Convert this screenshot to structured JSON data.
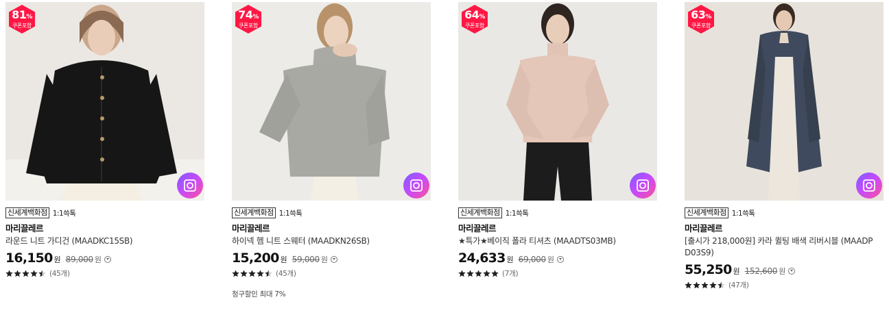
{
  "colors": {
    "badge": "#ff1744",
    "text": "#111111",
    "muted": "#666666"
  },
  "products": [
    {
      "discount": "81",
      "pct_sign": "%",
      "coupon": "쿠폰포함",
      "dept": "신세계백화점",
      "talk": "1:1쓱톡",
      "brand": "마리끌레르",
      "name": "라운드 니트 가디건 (MAADKC15SB)",
      "price": "16,150",
      "won": "원",
      "orig_price": "89,000",
      "rating": 4.5,
      "reviews": "(45개)",
      "note": ""
    },
    {
      "discount": "74",
      "pct_sign": "%",
      "coupon": "쿠폰포함",
      "dept": "신세계백화점",
      "talk": "1:1쓱톡",
      "brand": "마리끌레르",
      "name": "하이넥 헴 니트 스웨터 (MAADKN26SB)",
      "price": "15,200",
      "won": "원",
      "orig_price": "59,000",
      "rating": 4.5,
      "reviews": "(45개)",
      "note": "청구할인 최대 7%"
    },
    {
      "discount": "64",
      "pct_sign": "%",
      "coupon": "쿠폰포함",
      "dept": "신세계백화점",
      "talk": "1:1쓱톡",
      "brand": "마리끌레르",
      "name": "★특가★베이직 폴라 티셔츠 (MAADTS03MB)",
      "price": "24,633",
      "won": "원",
      "orig_price": "69,000",
      "rating": 5,
      "reviews": "(7개)",
      "note": ""
    },
    {
      "discount": "63",
      "pct_sign": "%",
      "coupon": "쿠폰포함",
      "dept": "신세계백화점",
      "talk": "1:1쓱톡",
      "brand": "마리끌레르",
      "name": "[출시가 218,000원] 카라 퀼팅 배색 리버시블 (MAADP D03S9)",
      "price": "55,250",
      "won": "원",
      "orig_price": "152,600",
      "rating": 4.5,
      "reviews": "(47개)",
      "note": ""
    }
  ]
}
